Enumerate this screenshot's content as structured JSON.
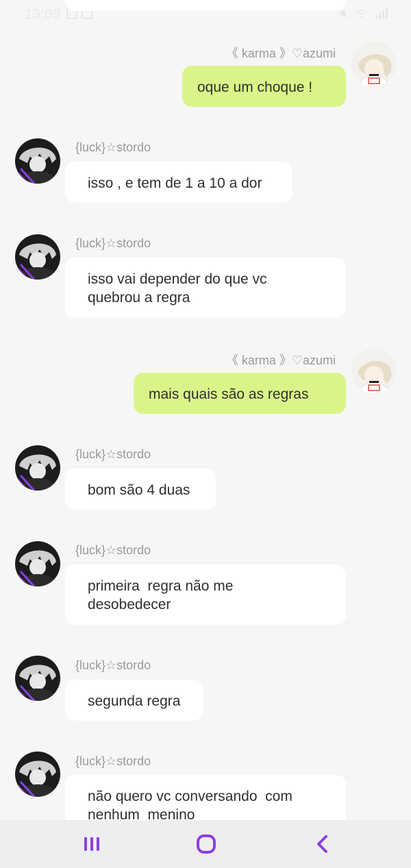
{
  "status_bar": {
    "time": "13:09",
    "icons_left": [
      "image-icon",
      "calendar-icon"
    ],
    "icons_right": [
      "mute-icon",
      "wifi-icon",
      "signal-icon"
    ]
  },
  "colors": {
    "background": "#f6f6f6",
    "incoming_bubble": "#ffffff",
    "outgoing_bubble": "#d9f58a",
    "name_text": "#9a9a9a",
    "nav_accent": "#8d3ee0"
  },
  "messages": [
    {
      "sender": "《 karma 》♡azumi",
      "direction": "outgoing",
      "lines": [
        "oque um choque !"
      ]
    },
    {
      "sender": "{luck}☆stordo",
      "direction": "incoming",
      "lines": [
        "isso , e tem de 1 a 10 a dor"
      ]
    },
    {
      "sender": "{luck}☆stordo",
      "direction": "incoming",
      "lines": [
        "isso vai depender do que vc",
        "quebrou a regra"
      ]
    },
    {
      "sender": "《 karma 》♡azumi",
      "direction": "outgoing",
      "lines": [
        "mais quais são as regras"
      ]
    },
    {
      "sender": "{luck}☆stordo",
      "direction": "incoming",
      "lines": [
        "bom são 4 duas"
      ]
    },
    {
      "sender": "{luck}☆stordo",
      "direction": "incoming",
      "lines": [
        "primeira  regra não me",
        "desobedecer"
      ]
    },
    {
      "sender": "{luck}☆stordo",
      "direction": "incoming",
      "lines": [
        "segunda regra"
      ]
    },
    {
      "sender": "{luck}☆stordo",
      "direction": "incoming",
      "lines": [
        "não quero vc conversando  com",
        "nenhum  menino"
      ]
    }
  ],
  "nav_bar": {
    "items": [
      "recent-apps-icon",
      "home-icon",
      "back-icon"
    ]
  }
}
